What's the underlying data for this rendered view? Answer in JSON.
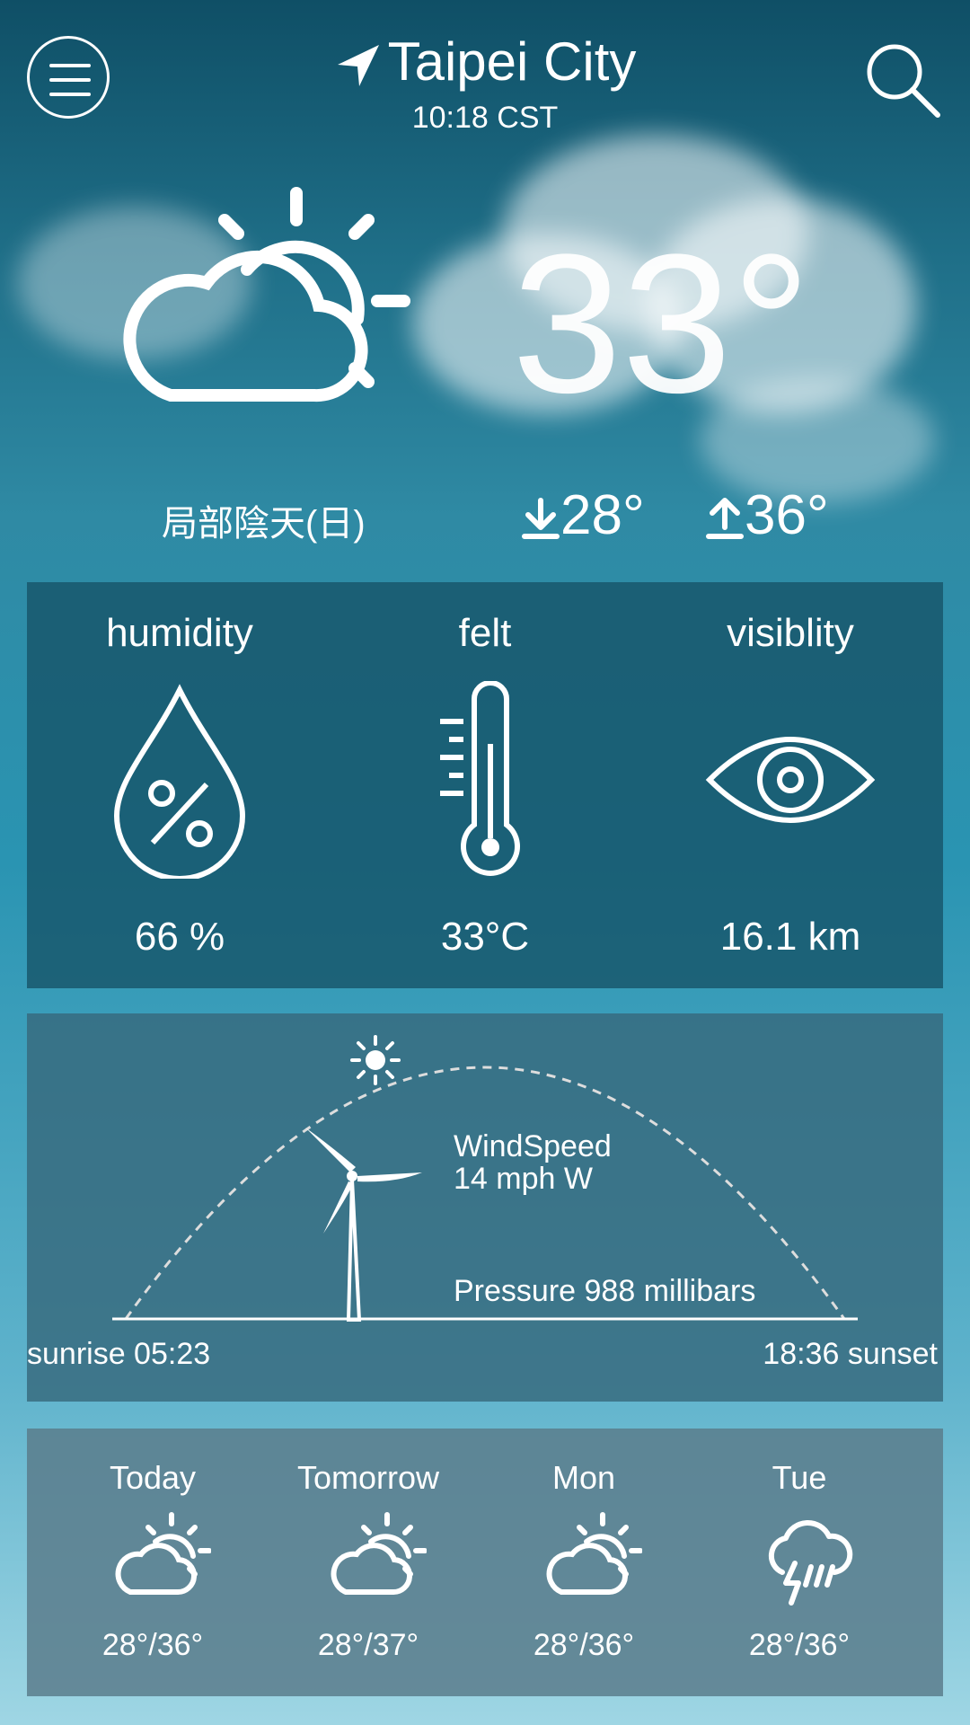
{
  "header": {
    "city": "Taipei City",
    "time": "10:18 CST",
    "menu_icon": "hamburger-menu-icon",
    "search_icon": "search-icon",
    "location_icon": "location-arrow-icon"
  },
  "current": {
    "temperature": "33°",
    "condition": "局部陰天(日)",
    "low": "28°",
    "high": "36°",
    "icon": "partly-cloudy-day-icon"
  },
  "stats": [
    {
      "label": "humidity",
      "value": "66 %",
      "icon": "humidity-drop-icon"
    },
    {
      "label": "felt",
      "value": "33°C",
      "icon": "thermometer-icon"
    },
    {
      "label": "visiblity",
      "value": "16.1 km",
      "icon": "eye-icon"
    }
  ],
  "sun": {
    "wind_title": "WindSpeed",
    "wind_value": "14 mph W",
    "pressure": "Pressure 988 millibars",
    "sunrise": "sunrise 05:23",
    "sunset": "18:36 sunset"
  },
  "forecast": [
    {
      "day": "Today",
      "range": "28°/36°",
      "icon": "partly-cloudy-day-icon"
    },
    {
      "day": "Tomorrow",
      "range": "28°/37°",
      "icon": "partly-cloudy-day-icon"
    },
    {
      "day": "Mon",
      "range": "28°/36°",
      "icon": "partly-cloudy-day-icon"
    },
    {
      "day": "Tue",
      "range": "28°/36°",
      "icon": "thunderstorm-icon"
    }
  ],
  "colors": {
    "text": "#ffffff",
    "panel": "#1f5a6e"
  }
}
